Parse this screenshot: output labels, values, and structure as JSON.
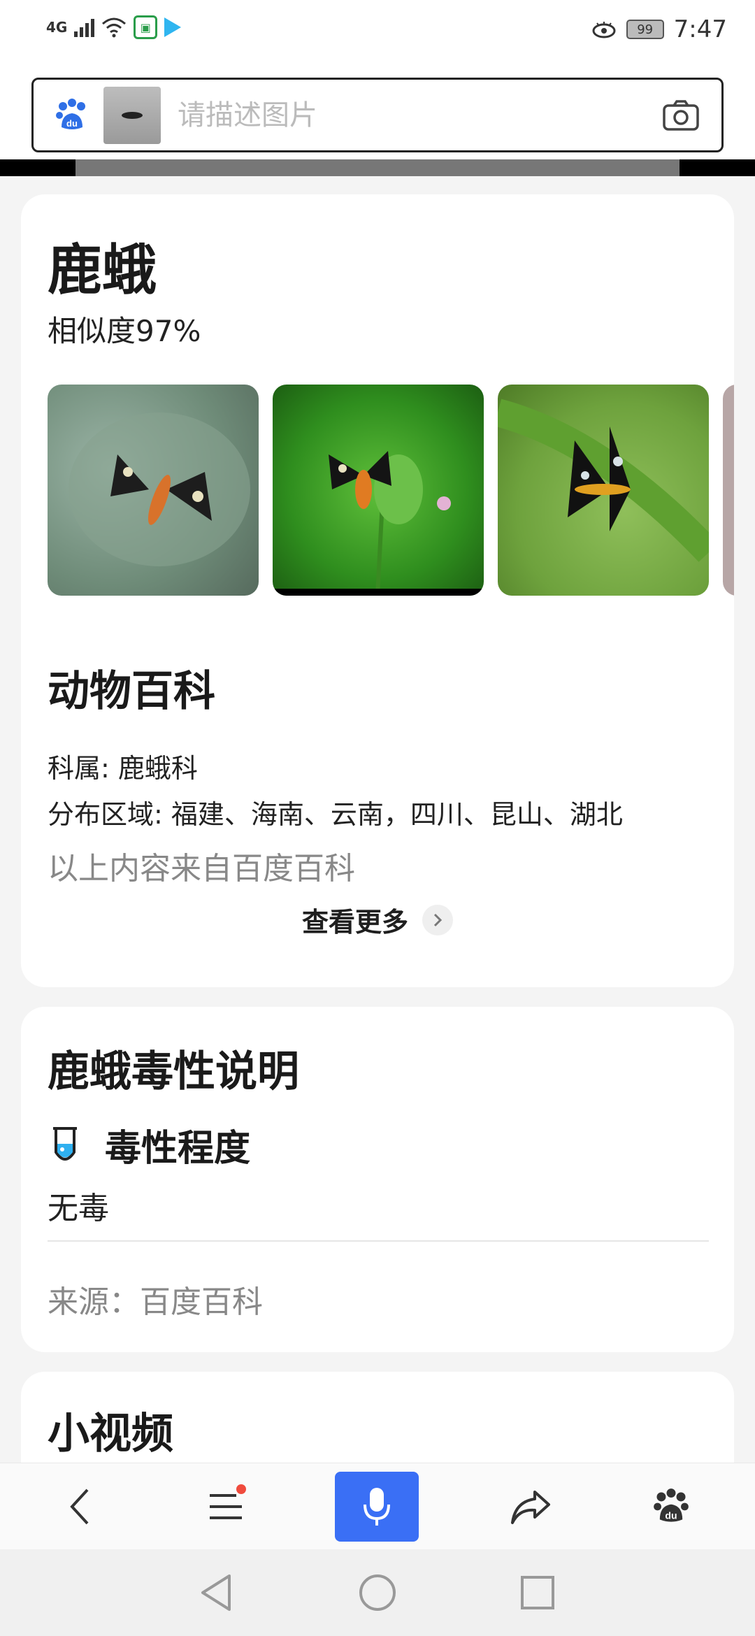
{
  "status_bar": {
    "network": "4G",
    "battery": "99",
    "time": "7:47",
    "icons": [
      "signal-icon",
      "wifi-icon",
      "app-icon",
      "play-icon",
      "eye-icon",
      "battery-icon"
    ]
  },
  "search": {
    "placeholder": "请描述图片",
    "icons": [
      "baidu-paw-icon",
      "camera-icon"
    ]
  },
  "result": {
    "title": "鹿蛾",
    "similarity": "相似度97%"
  },
  "encyclopedia": {
    "heading": "动物百科",
    "family": "科属: 鹿蛾科",
    "distribution": "分布区域: 福建、海南、云南，四川、昆山、湖北",
    "source_note": "以上内容来自百度百科",
    "more_label": "查看更多"
  },
  "toxicity": {
    "heading": "鹿蛾毒性说明",
    "sub_heading": "毒性程度",
    "value": "无毒",
    "source": "来源：百度百科"
  },
  "video": {
    "heading": "小视频"
  },
  "bottom_nav": {
    "icons": [
      "back-icon",
      "menu-icon",
      "mic-icon",
      "share-icon",
      "baidu-icon"
    ]
  },
  "system_nav": {
    "icons": [
      "triangle-back-icon",
      "circle-home-icon",
      "square-recent-icon"
    ]
  },
  "colors": {
    "accent": "#3a6ff5",
    "baidu_blue": "#2f6fe6",
    "badge_red": "#f04b3d"
  }
}
